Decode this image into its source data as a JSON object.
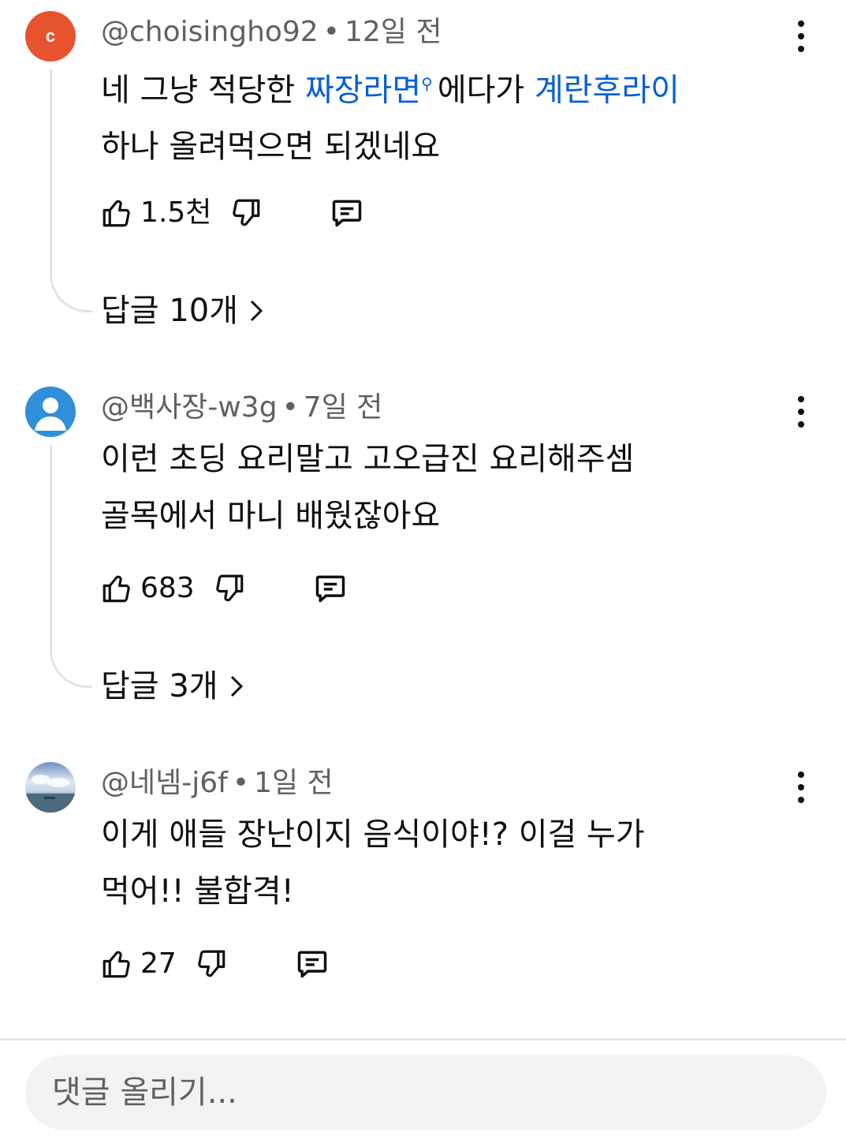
{
  "comments": [
    {
      "avatar_letter": "c",
      "author": "@choisingho92",
      "separator": "•",
      "time": "12일 전",
      "text_parts": [
        "네 그냥 적당한 ",
        "짜장라면",
        "에다가 ",
        "계란후라이",
        "하나 올려먹으면 되겠네요"
      ],
      "likes": "1.5천",
      "replies_label": "답글 10개"
    },
    {
      "author": "@백사장-w3g",
      "separator": "•",
      "time": "7일 전",
      "text_line1": "이런 초딩 요리말고  고오급진 요리해주셈",
      "text_line2": "골목에서 마니 배웠잖아요",
      "likes": "683",
      "replies_label": "답글 3개"
    },
    {
      "author": "@네넴-j6f",
      "separator": "•",
      "time": "1일 전",
      "text_line1": "이게 애들 장난이지 음식이야!? 이걸 누가",
      "text_line2": "먹어!! 불합격!",
      "likes": "27"
    }
  ],
  "composer": {
    "placeholder": "댓글 올리기..."
  },
  "colors": {
    "link": "#065fd4",
    "meta": "#606060",
    "avatar_c": "#e8532f",
    "avatar_default": "#2f8fd8"
  }
}
